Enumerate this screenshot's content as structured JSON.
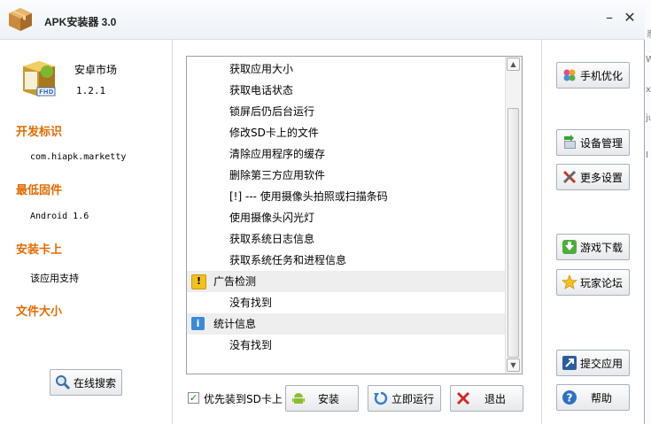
{
  "window": {
    "title": "APK安装器 3.0"
  },
  "app": {
    "name": "安卓市场",
    "version": "1.2.1",
    "icon": "fhd-package-icon"
  },
  "info": {
    "developer_title": "开发标识",
    "developer_value": "com.hiapk.marketty",
    "firmware_title": "最低固件",
    "firmware_value": "Android 1.6",
    "sd_title": "安装卡上",
    "sd_value": "该应用支持",
    "size_title": "文件大小",
    "size_value": ""
  },
  "buttons": {
    "online_search": "在线搜索",
    "phone_optimize": "手机优化",
    "device_manage": "设备管理",
    "more_settings": "更多设置",
    "game_download": "游戏下载",
    "player_forum": "玩家论坛",
    "submit_app": "提交应用",
    "help": "帮助",
    "install": "安装",
    "run_now": "立即运行",
    "exit": "退出"
  },
  "install_option": {
    "label": "优先装到SD卡上",
    "checked": true
  },
  "permissions_list": {
    "rows": [
      {
        "type": "item",
        "text": "获取应用大小"
      },
      {
        "type": "item",
        "text": "获取电话状态"
      },
      {
        "type": "item",
        "text": "锁屏后仍后台运行"
      },
      {
        "type": "item",
        "text": "修改SD卡上的文件"
      },
      {
        "type": "item",
        "text": "清除应用程序的缓存"
      },
      {
        "type": "item",
        "text": "删除第三方应用软件"
      },
      {
        "type": "item",
        "text": "[!] --- 使用摄像头拍照或扫描条码"
      },
      {
        "type": "item",
        "text": "使用摄像头闪光灯"
      },
      {
        "type": "item",
        "text": "获取系统日志信息"
      },
      {
        "type": "item",
        "text": "获取系统任务和进程信息"
      },
      {
        "type": "group",
        "text": "广告检测",
        "icon": "warning-icon"
      },
      {
        "type": "item",
        "text": "没有找到"
      },
      {
        "type": "group",
        "text": "统计信息",
        "icon": "info-icon"
      },
      {
        "type": "item",
        "text": "没有找到"
      }
    ]
  },
  "outside_fragments": [
    "豸",
    "W",
    "x",
    "ju",
    "I"
  ],
  "colors": {
    "section_title": "#e26b00",
    "group_row_bg": "#eeeeee",
    "accent_blue": "#2f7fd0"
  }
}
